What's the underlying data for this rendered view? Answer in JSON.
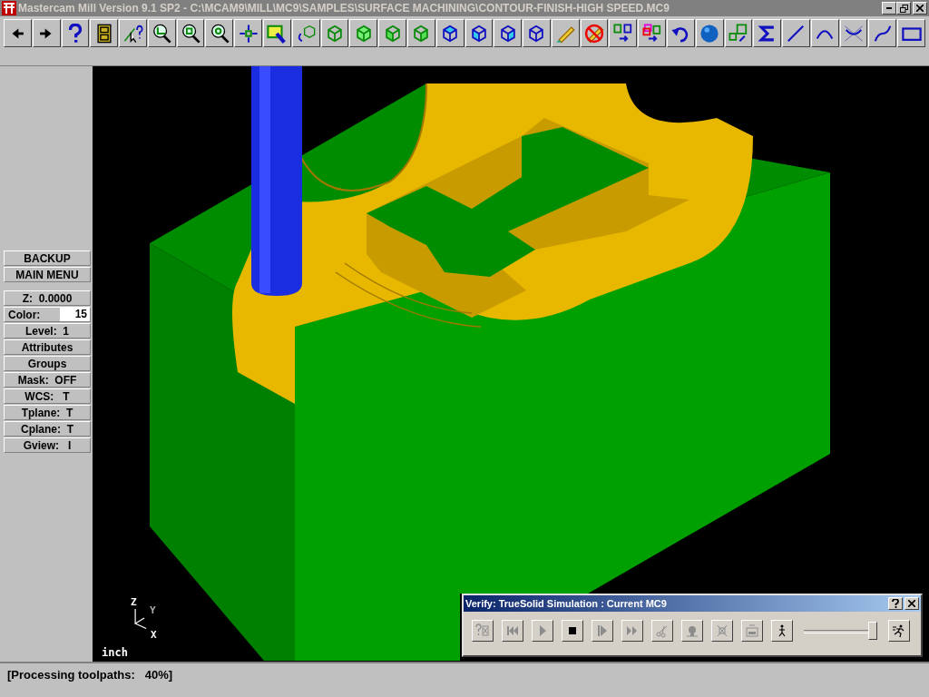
{
  "window": {
    "title": "Mastercam Mill Version 9.1 SP2 - C:\\MCAM9\\MILL\\MC9\\SAMPLES\\SURFACE MACHINING\\CONTOUR-FINISH-HIGH SPEED.MC9"
  },
  "menu": [
    {
      "kind": "button",
      "label": "BACKUP"
    },
    {
      "kind": "button",
      "label": "MAIN MENU"
    },
    {
      "kind": "gap"
    },
    {
      "kind": "button",
      "label": "Z:  0.0000"
    },
    {
      "kind": "field",
      "label": "Color:",
      "value": "15"
    },
    {
      "kind": "button",
      "label": "Level:  1"
    },
    {
      "kind": "button",
      "label": "Attributes"
    },
    {
      "kind": "button",
      "label": "Groups"
    },
    {
      "kind": "button",
      "label": "Mask:  OFF"
    },
    {
      "kind": "button",
      "label": "WCS:   T"
    },
    {
      "kind": "button",
      "label": "Tplane:  T"
    },
    {
      "kind": "button",
      "label": "Cplane:  T"
    },
    {
      "kind": "button",
      "label": "Gview:   I"
    }
  ],
  "viewport": {
    "axes": [
      "Z",
      "Y",
      "X"
    ],
    "units": "inch"
  },
  "verify_dialog": {
    "title": "Verify: TrueSolid Simulation : Current MC9",
    "buttons": [
      {
        "disabled": true
      },
      {
        "disabled": true
      },
      {
        "disabled": true
      },
      {
        "disabled": false
      },
      {
        "disabled": true
      },
      {
        "disabled": true
      },
      {
        "disabled": true
      },
      {
        "disabled": true
      },
      {
        "disabled": true
      },
      {
        "disabled": true
      },
      {
        "disabled": false
      }
    ],
    "speed_slider": {
      "level": 0.95
    },
    "end_button": {
      "disabled": false
    }
  },
  "status_bar": "[Processing toolpaths:   40%]"
}
